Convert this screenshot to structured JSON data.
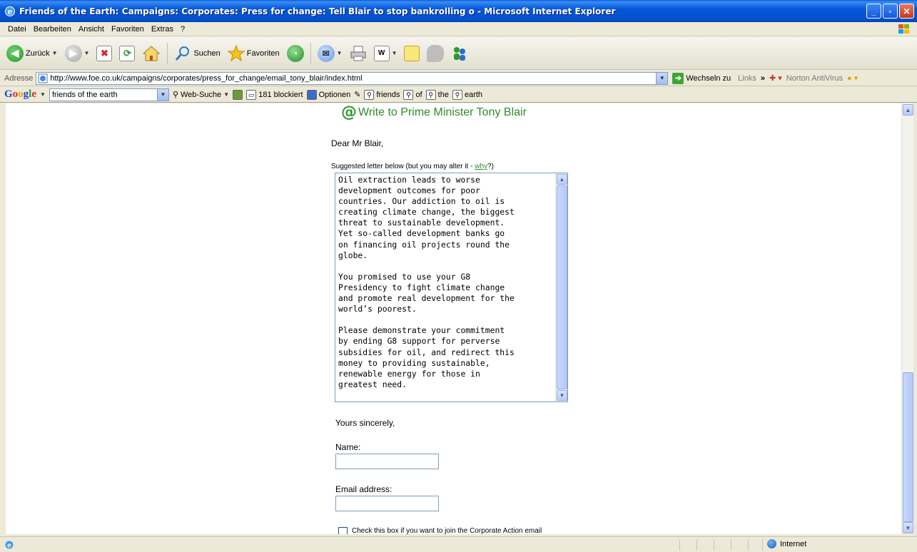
{
  "window": {
    "title": "Friends of the Earth: Campaigns: Corporates: Press for change: Tell Blair to stop bankrolling o - Microsoft Internet Explorer",
    "min": "_",
    "max": "▫",
    "close": "✕"
  },
  "menu": [
    "Datei",
    "Bearbeiten",
    "Ansicht",
    "Favoriten",
    "Extras",
    "?"
  ],
  "toolbar": {
    "back": "Zurück",
    "search": "Suchen",
    "favorites": "Favoriten"
  },
  "address": {
    "label": "Adresse",
    "url": "http://www.foe.co.uk/campaigns/corporates/press_for_change/email_tony_blair/index.html",
    "go": "Wechseln zu",
    "links": "Links",
    "more": "»",
    "norton": "Norton AntiVirus"
  },
  "google": {
    "logo": [
      "G",
      "o",
      "o",
      "g",
      "l",
      "e"
    ],
    "query": "friends of the earth",
    "web_search": "Web-Suche",
    "blocked": "181 blockiert",
    "options": "Optionen",
    "terms": [
      "friends",
      "of",
      "the",
      "earth"
    ]
  },
  "page": {
    "heading": "Write to Prime Minister Tony Blair",
    "greeting": "Dear Mr Blair,",
    "suggest_prefix": "Suggested letter below (but you may alter it - ",
    "suggest_link": "why",
    "suggest_suffix": "?)",
    "letter": "Oil extraction leads to worse\ndevelopment outcomes for poor\ncountries. Our addiction to oil is\ncreating climate change, the biggest\nthreat to sustainable development.\nYet so-called development banks go\non financing oil projects round the\nglobe.\n\nYou promised to use your G8\nPresidency to fight climate change\nand promote real development for the\nworld’s poorest.\n\nPlease demonstrate your commitment\nby ending G8 support for perverse\nsubsidies for oil, and redirect this\nmoney to providing sustainable,\nrenewable energy for those in\ngreatest need.",
    "closing": "Yours sincerely,",
    "name_label": "Name:",
    "name_value": "",
    "email_label": "Email address:",
    "email_value": "",
    "checkbox_label": "Check this box if you want to join the Corporate Action email"
  },
  "status": {
    "zone": "Internet"
  },
  "colors": {
    "titlebar": "#0558d8",
    "link_green": "#2e8b2e"
  }
}
